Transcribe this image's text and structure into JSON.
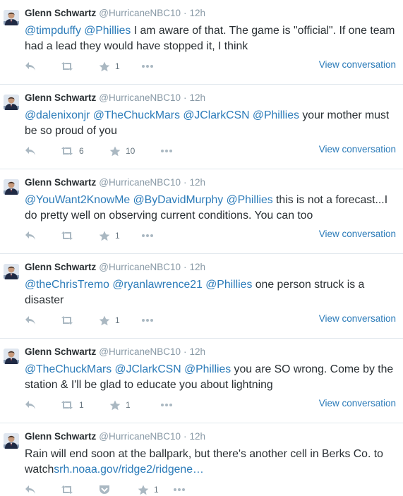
{
  "tweets": [
    {
      "name": "Glenn Schwartz",
      "handle": "@HurricaneNBC10",
      "separator": "·",
      "time": "12h",
      "segments": [
        {
          "t": "@timpduffy",
          "type": "mention"
        },
        {
          "t": " ",
          "type": "text"
        },
        {
          "t": "@Phillies",
          "type": "mention"
        },
        {
          "t": " I am aware of that. The game is \"official\". If one team had a lead they would have stopped it, I think",
          "type": "text"
        }
      ],
      "retweets": "",
      "favorites": "1",
      "has_pocket": false,
      "view_conversation": "View conversation"
    },
    {
      "name": "Glenn Schwartz",
      "handle": "@HurricaneNBC10",
      "separator": "·",
      "time": "12h",
      "segments": [
        {
          "t": "@dalenixonjr",
          "type": "mention"
        },
        {
          "t": " ",
          "type": "text"
        },
        {
          "t": "@TheChuckMars",
          "type": "mention"
        },
        {
          "t": " ",
          "type": "text"
        },
        {
          "t": "@JClarkCSN",
          "type": "mention"
        },
        {
          "t": " ",
          "type": "text"
        },
        {
          "t": "@Phillies",
          "type": "mention"
        },
        {
          "t": " your mother must be so proud of you",
          "type": "text"
        }
      ],
      "retweets": "6",
      "favorites": "10",
      "has_pocket": false,
      "view_conversation": "View conversation"
    },
    {
      "name": "Glenn Schwartz",
      "handle": "@HurricaneNBC10",
      "separator": "·",
      "time": "12h",
      "segments": [
        {
          "t": "@YouWant2KnowMe",
          "type": "mention"
        },
        {
          "t": " ",
          "type": "text"
        },
        {
          "t": "@ByDavidMurphy",
          "type": "mention"
        },
        {
          "t": " ",
          "type": "text"
        },
        {
          "t": "@Phillies",
          "type": "mention"
        },
        {
          "t": " this is not a forecast...I do pretty well on observing current conditions. You can too",
          "type": "text"
        }
      ],
      "retweets": "",
      "favorites": "1",
      "has_pocket": false,
      "view_conversation": "View conversation"
    },
    {
      "name": "Glenn Schwartz",
      "handle": "@HurricaneNBC10",
      "separator": "·",
      "time": "12h",
      "segments": [
        {
          "t": "@theChrisTremo",
          "type": "mention"
        },
        {
          "t": " ",
          "type": "text"
        },
        {
          "t": "@ryanlawrence21",
          "type": "mention"
        },
        {
          "t": " ",
          "type": "text"
        },
        {
          "t": "@Phillies",
          "type": "mention"
        },
        {
          "t": " one person struck is a disaster",
          "type": "text"
        }
      ],
      "retweets": "",
      "favorites": "1",
      "has_pocket": false,
      "view_conversation": "View conversation"
    },
    {
      "name": "Glenn Schwartz",
      "handle": "@HurricaneNBC10",
      "separator": "·",
      "time": "12h",
      "segments": [
        {
          "t": "@TheChuckMars",
          "type": "mention"
        },
        {
          "t": " ",
          "type": "text"
        },
        {
          "t": "@JClarkCSN",
          "type": "mention"
        },
        {
          "t": " ",
          "type": "text"
        },
        {
          "t": "@Phillies",
          "type": "mention"
        },
        {
          "t": " you are SO wrong. Come by the station & I'll be glad to educate you about lightning",
          "type": "text"
        }
      ],
      "retweets": "1",
      "favorites": "1",
      "has_pocket": false,
      "view_conversation": "View conversation"
    },
    {
      "name": "Glenn Schwartz",
      "handle": "@HurricaneNBC10",
      "separator": "·",
      "time": "12h",
      "segments": [
        {
          "t": "Rain will end soon at the ballpark, but there's another cell in Berks Co. to watch",
          "type": "text"
        },
        {
          "t": "srh.noaa.gov/ridge2/ridgene…",
          "type": "link"
        }
      ],
      "retweets": "",
      "favorites": "1",
      "has_pocket": true,
      "view_conversation": ""
    }
  ],
  "icons": {
    "reply": "reply-icon",
    "retweet": "retweet-icon",
    "favorite": "star-icon",
    "more": "more-icon",
    "pocket": "pocket-icon"
  },
  "colors": {
    "link": "#2b7bb9",
    "muted": "#8899a6",
    "icon": "#aab8c2",
    "divider": "#e1e8ed"
  }
}
